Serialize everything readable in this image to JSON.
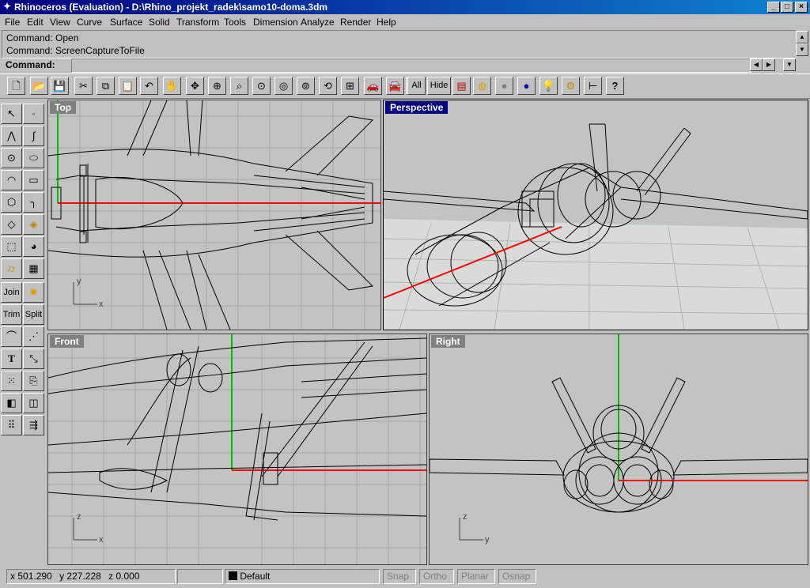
{
  "window": {
    "title": "Rhinoceros (Evaluation) - D:\\Rhino_projekt_radek\\samo10-doma.3dm",
    "controls": [
      "_",
      "□",
      "×"
    ]
  },
  "menu": [
    "File",
    "Edit",
    "View",
    "Curve",
    "Surface",
    "Solid",
    "Transform",
    "Tools",
    "Dimension",
    "Analyze",
    "Render",
    "Help"
  ],
  "command": {
    "history": [
      "Command: Open",
      "Command: ScreenCaptureToFile"
    ],
    "prompt_label": "Command:",
    "value": ""
  },
  "toolbar": {
    "all_label": "All",
    "hide_label": "Hide",
    "icons": [
      "new-file",
      "open-folder",
      "save",
      "cut",
      "copy",
      "paste",
      "undo",
      "pan-hand",
      "rotate-view",
      "zoom-dynamic",
      "zoom-window",
      "zoom-target",
      "zoom-selected",
      "zoom-extents",
      "undo-view",
      "four-viewports",
      "shade-car",
      "render-car",
      "point-edit",
      "show-all",
      "hide",
      "layers",
      "color-wheel",
      "material-sphere",
      "blue-sphere",
      "light-bulb",
      "gear-options",
      "dimension",
      "help"
    ]
  },
  "tools": {
    "join_label": "Join",
    "trim_label": "Trim",
    "split_label": "Split"
  },
  "viewports": {
    "top": {
      "label": "Top",
      "axis_x": "x",
      "axis_y": "y"
    },
    "perspective": {
      "label": "Perspective"
    },
    "front": {
      "label": "Front",
      "axis_x": "x",
      "axis_y": "z"
    },
    "right": {
      "label": "Right",
      "axis_x": "y",
      "axis_y": "z"
    }
  },
  "status": {
    "x_label": "x",
    "x_value": "501.290",
    "y_label": "y",
    "y_value": "227.228",
    "z_label": "z",
    "z_value": "0.000",
    "layer": "Default",
    "snap": "Snap",
    "ortho": "Ortho",
    "planar": "Planar",
    "osnap": "Osnap"
  },
  "colors": {
    "title_active": "#000080",
    "viewport_bg": "#c3c3c3",
    "grid": "#a7a7a7",
    "x_axis": "#ff0000",
    "y_axis": "#00c000"
  }
}
